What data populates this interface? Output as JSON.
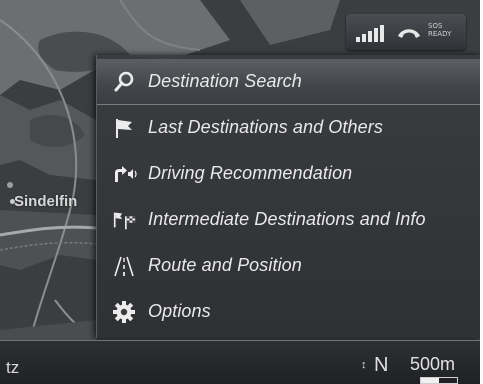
{
  "status_bar": {
    "signal_icon": "signal-strength-icon",
    "phone_icon": "phone-handset-icon",
    "sos_line1": "SOS",
    "sos_line2": "READY"
  },
  "map": {
    "city_label": "Sindelfin"
  },
  "menu": {
    "items": [
      {
        "label": "Destination Search",
        "icon": "search-magnifier-icon",
        "selected": true
      },
      {
        "label": "Last Destinations and Others",
        "icon": "flag-icon",
        "selected": false
      },
      {
        "label": "Driving Recommendation",
        "icon": "turn-arrow-speaker-icon",
        "selected": false
      },
      {
        "label": "Intermediate Destinations and Info",
        "icon": "intermediate-flags-icon",
        "selected": false
      },
      {
        "label": "Route and Position",
        "icon": "road-icon",
        "selected": false
      },
      {
        "label": "Options",
        "icon": "gear-icon",
        "selected": false
      }
    ]
  },
  "bottom_bar": {
    "left_text": "tz",
    "compass_label": "N",
    "scale_label": "500m"
  },
  "colors": {
    "menu_bg": "#3a3c3f",
    "selected_bg": "#55595d",
    "text": "#e9e9e9"
  }
}
